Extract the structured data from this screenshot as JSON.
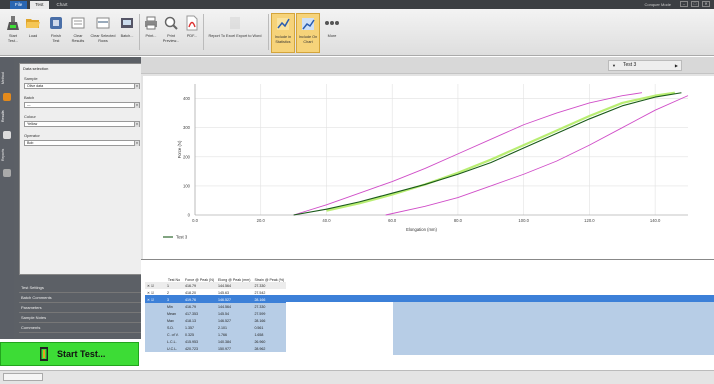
{
  "titlebar": {
    "tabs": [
      "File",
      "Test",
      "Chart"
    ],
    "right_text": "Conquer Mode",
    "controls": [
      "–",
      "□",
      "✕"
    ]
  },
  "ribbon": {
    "buttons": [
      {
        "label": "Start Test...",
        "icon": "flask-icon"
      },
      {
        "label": "Load",
        "icon": "open-folder-icon"
      },
      {
        "label": "Finish Test",
        "icon": "finish-icon"
      },
      {
        "label": "Clear Results",
        "icon": "clear-icon"
      },
      {
        "label": "Clear Selected Rows",
        "icon": "clear-rows-icon"
      },
      {
        "label": "Batch...",
        "icon": "batch-icon"
      },
      {
        "label": "Print...",
        "icon": "printer-icon"
      },
      {
        "label": "Print Preview...",
        "icon": "print-preview-icon"
      },
      {
        "label": "PDF...",
        "icon": "pdf-icon"
      },
      {
        "label": "Report To Excel Export to Word",
        "icon": "report-icon"
      },
      {
        "label": "Include in Statistics",
        "icon": "include-stats-icon"
      },
      {
        "label": "Include On Chart",
        "icon": "include-chart-icon"
      },
      {
        "label": "More",
        "icon": "more-icon"
      }
    ]
  },
  "rail": {
    "items": [
      "Method",
      "Results",
      "Reports"
    ]
  },
  "filter": {
    "title": "Data selection",
    "fields": [
      {
        "label": "Sample",
        "value": "Olive data"
      },
      {
        "label": "Batch",
        "value": "—"
      },
      {
        "label": "Colour",
        "value": "Yellow"
      },
      {
        "label": "Operator",
        "value": "Bob"
      }
    ]
  },
  "accordion": [
    "Test Settings",
    "Batch Comments",
    "Parameters",
    "Sample Notes",
    "Comments"
  ],
  "start_button": {
    "label": "Start Test..."
  },
  "test_selector": {
    "value": "Test 3"
  },
  "chart_data": {
    "type": "line",
    "xlabel": "Elongation (mm)",
    "ylabel": "Force (N)",
    "xlim": [
      0,
      150
    ],
    "ylim": [
      0,
      450
    ],
    "xticks": [
      0,
      20,
      40,
      60,
      80,
      100,
      120,
      140
    ],
    "yticks": [
      0,
      100,
      200,
      300,
      400
    ],
    "grid": true,
    "legend": "bottom-left",
    "series": [
      {
        "name": "Test 3",
        "color": "#1a5a1a",
        "x": [
          30,
          40,
          50,
          60,
          70,
          80,
          90,
          100,
          110,
          120,
          130,
          140,
          148
        ],
        "y": [
          0,
          20,
          45,
          75,
          105,
          140,
          180,
          230,
          280,
          330,
          375,
          405,
          420
        ]
      },
      {
        "color": "#d04ec8",
        "x": [
          30,
          40,
          50,
          60,
          70,
          80,
          90,
          100,
          110,
          120,
          130,
          136
        ],
        "y": [
          0,
          35,
          75,
          115,
          160,
          210,
          260,
          310,
          350,
          385,
          410,
          420
        ]
      },
      {
        "color": "#d04ec8",
        "x": [
          58,
          70,
          80,
          90,
          100,
          110,
          120,
          130,
          140,
          150
        ],
        "y": [
          0,
          30,
          60,
          100,
          140,
          185,
          240,
          300,
          360,
          410
        ]
      },
      {
        "color": "#b9ee73",
        "x": [
          40,
          50,
          60,
          70,
          80,
          90,
          100,
          110,
          120,
          130,
          140,
          146
        ],
        "y": [
          15,
          40,
          70,
          105,
          145,
          190,
          240,
          290,
          340,
          385,
          410,
          420
        ]
      }
    ]
  },
  "table": {
    "headers": [
      "Test No",
      "Force @ Peak (N)",
      "Elong @ Peak (mm)",
      "Strain @ Peak (%)"
    ],
    "rows": [
      {
        "no": "1",
        "force": "416.79",
        "elong": "144.564",
        "strain": "27.330",
        "checked": true
      },
      {
        "no": "2",
        "force": "418.20",
        "elong": "145.63",
        "strain": "27.542",
        "checked": true
      },
      {
        "no": "3",
        "force": "419.76",
        "elong": "146.527",
        "strain": "28.166",
        "checked": true
      }
    ],
    "stats": [
      {
        "label": "Min",
        "force": "416.79",
        "elong": "144.564",
        "strain": "27.330"
      },
      {
        "label": "Mean",
        "force": "417.353",
        "elong": "145.54",
        "strain": "27.599"
      },
      {
        "label": "Max",
        "force": "418.13",
        "elong": "146.527",
        "strain": "28.166"
      },
      {
        "label": "S.D.",
        "force": "1.357",
        "elong": "2.101",
        "strain": "0.561"
      },
      {
        "label": "C. of V.",
        "force": "0.325",
        "elong": "1.766",
        "strain": "1.658"
      },
      {
        "label": "L.C.L.",
        "force": "415.953",
        "elong": "140.384",
        "strain": "26.960"
      },
      {
        "label": "U.C.L.",
        "force": "420.723",
        "elong": "150.977",
        "strain": "28.962"
      }
    ]
  }
}
